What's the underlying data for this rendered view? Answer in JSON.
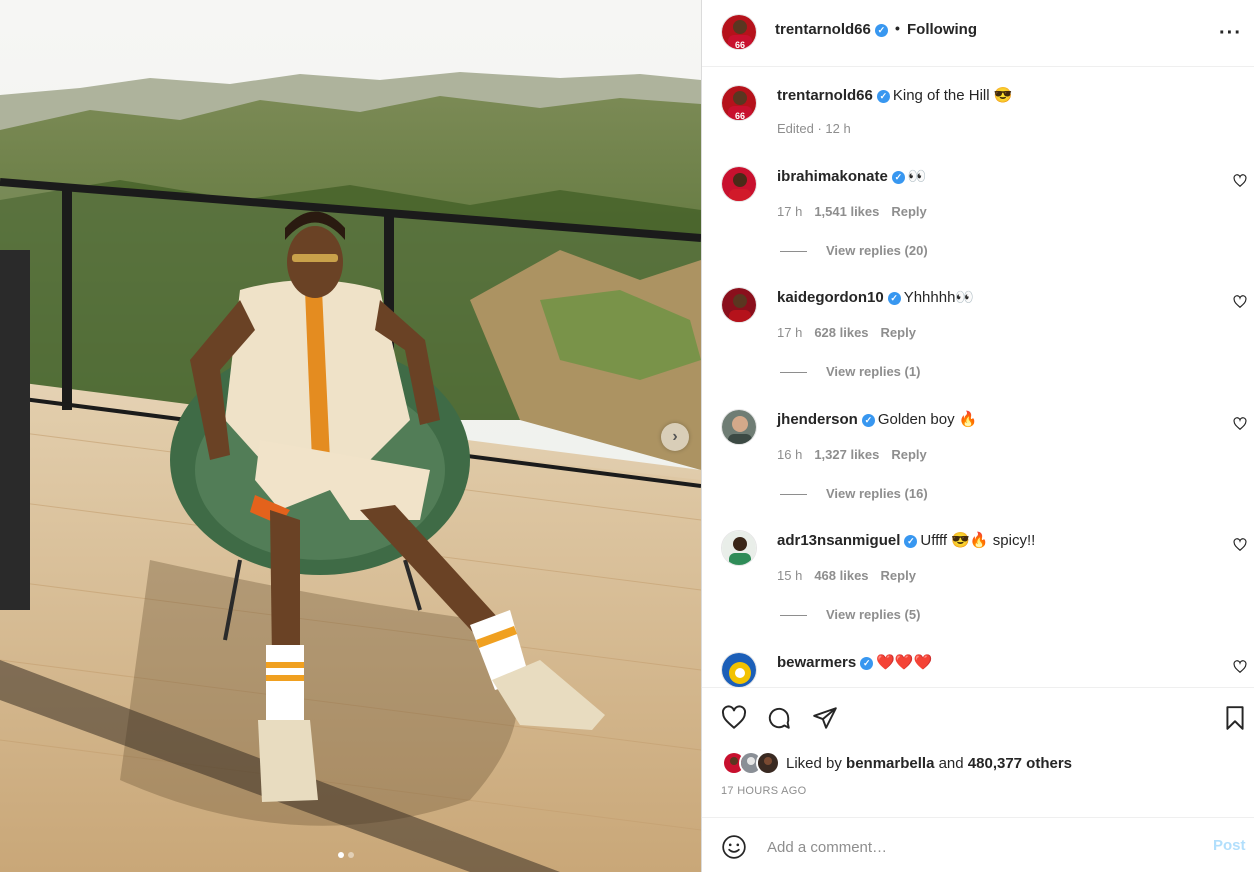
{
  "post": {
    "author": "trentarnold66",
    "follow_status": "Following",
    "header_separator": "•",
    "more_icon": "more-horizontal-icon"
  },
  "caption": {
    "username": "trentarnold66",
    "text": "King of the Hill 😎",
    "meta": "Edited · 12 h"
  },
  "comments": [
    {
      "username": "ibrahimakonate",
      "text": "👀",
      "time": "17 h",
      "likes": "1,541 likes",
      "reply": "Reply",
      "view_replies": "View replies (20)",
      "avatar_color": "#c8102e"
    },
    {
      "username": "kaidegordon10",
      "text": "Yhhhhh👀",
      "time": "17 h",
      "likes": "628 likes",
      "reply": "Reply",
      "view_replies": "View replies (1)",
      "avatar_color": "#a01020"
    },
    {
      "username": "jhenderson",
      "text": "Golden boy 🔥",
      "time": "16 h",
      "likes": "1,327 likes",
      "reply": "Reply",
      "view_replies": "View replies (16)",
      "avatar_color": "#5b6b63"
    },
    {
      "username": "adr13nsanmiguel",
      "text": "Uffff 😎🔥 spicy!!",
      "time": "15 h",
      "likes": "468 likes",
      "reply": "Reply",
      "view_replies": "View replies (5)",
      "avatar_color": "#2f8c58"
    },
    {
      "username": "bewarmers",
      "text": "❤️❤️❤️",
      "time": "",
      "likes": "",
      "reply": "",
      "view_replies": "",
      "avatar_color": "#f2c200"
    }
  ],
  "actions": {
    "like_icon": "heart-icon",
    "comment_icon": "comment-icon",
    "share_icon": "send-icon",
    "save_icon": "bookmark-icon"
  },
  "likes": {
    "prefix": "Liked by",
    "user": "benmarbella",
    "middle": "and",
    "others": "480,377 others"
  },
  "timestamp": "17 HOURS AGO",
  "comment_box": {
    "placeholder": "Add a comment…",
    "post_label": "Post"
  },
  "carousel": {
    "current": 1,
    "total": 2
  },
  "colors": {
    "verified": "#3897f0",
    "post_button": "#b2dffc",
    "muted": "#8e8e8e"
  }
}
